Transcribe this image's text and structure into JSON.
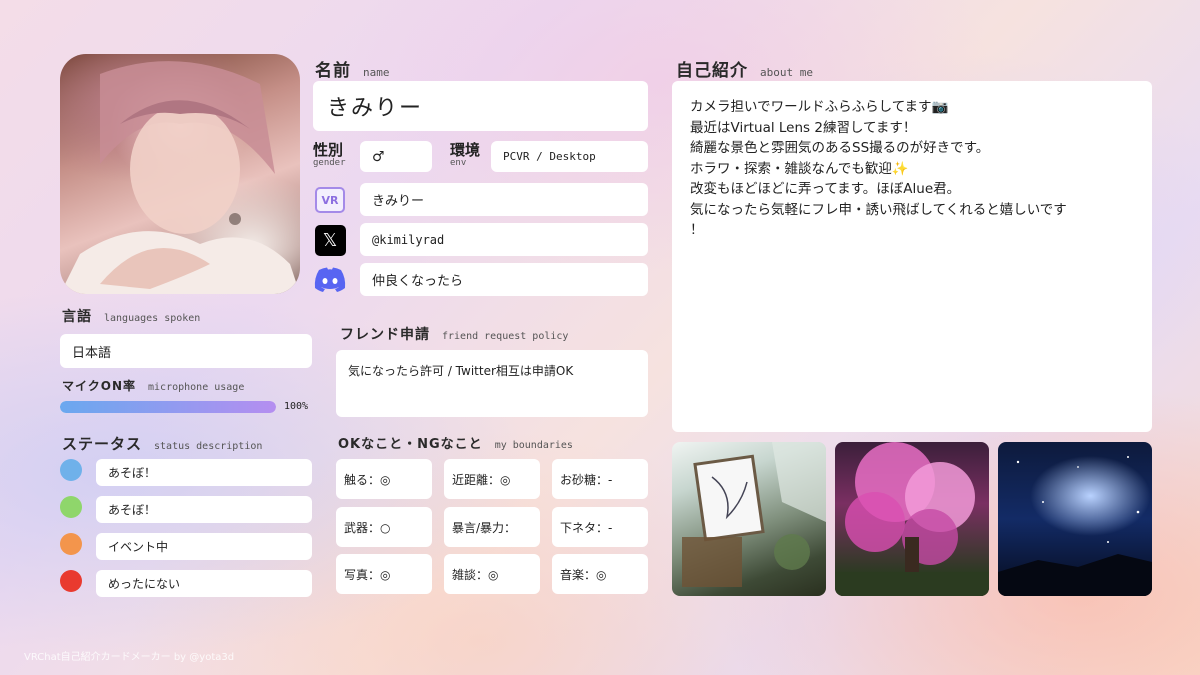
{
  "name": {
    "label_jp": "名前",
    "label_en": "name",
    "value": "きみりー"
  },
  "gender": {
    "label_jp": "性別",
    "label_en": "gender",
    "value": "♂"
  },
  "env": {
    "label_jp": "環境",
    "label_en": "env",
    "value": "PCVR / Desktop"
  },
  "accounts": {
    "vrchat": {
      "icon": "vrchat-icon",
      "icon_text": "VR",
      "value": "きみりー"
    },
    "x": {
      "icon": "x-icon",
      "icon_text": "𝕏",
      "value": "@kimilyrad"
    },
    "discord": {
      "icon": "discord-icon",
      "value": "仲良くなったら"
    }
  },
  "friend_request": {
    "label_jp": "フレンド申請",
    "label_en": "friend request policy",
    "value": "気になったら許可 / Twitter相互は申請OK"
  },
  "languages": {
    "label_jp": "言語",
    "label_en": "languages spoken",
    "value": "日本語"
  },
  "mic": {
    "label_jp": "マイクON率",
    "label_en": "microphone usage",
    "value_text": "100%",
    "percent": 100,
    "colors": [
      "#6aa8ef",
      "#b58ef0"
    ]
  },
  "status": {
    "label_jp": "ステータス",
    "label_en": "status description",
    "items": [
      {
        "color": "#6fb1ea",
        "text": "あそぼ！"
      },
      {
        "color": "#8fd66b",
        "text": "あそぼ！"
      },
      {
        "color": "#f3954c",
        "text": "イベント中"
      },
      {
        "color": "#e93a2f",
        "text": "めったにない"
      }
    ]
  },
  "boundaries": {
    "label_jp": "OKなこと・NGなこと",
    "label_en": "my boundaries",
    "items": [
      "触る：◎",
      "近距離：◎",
      "お砂糖：-",
      "武器：○",
      "暴言/暴力：",
      "下ネタ：-",
      "写真：◎",
      "雑談：◎",
      "音楽：◎"
    ]
  },
  "about": {
    "label_jp": "自己紹介",
    "label_en": "about me",
    "lines": [
      "カメラ担いでワールドふらふらしてます📷",
      "最近はVirtual Lens 2練習してます！",
      "綺麗な景色と雰囲気のあるSS撮るのが好きです。",
      "ホラワ・探索・雑談なんでも歓迎✨",
      "改変もほどほどに弄ってます。ほぼAlue君。",
      "気になったら気軽にフレ申・誘い飛ばしてくれると嬉しいです",
      "！"
    ]
  },
  "footer": "VRChat自己紹介カードメーカー by @yota3d",
  "colors": {
    "discord": "#5865f2",
    "vrchat_border": "#a48ae8",
    "x_bg": "#000000"
  }
}
